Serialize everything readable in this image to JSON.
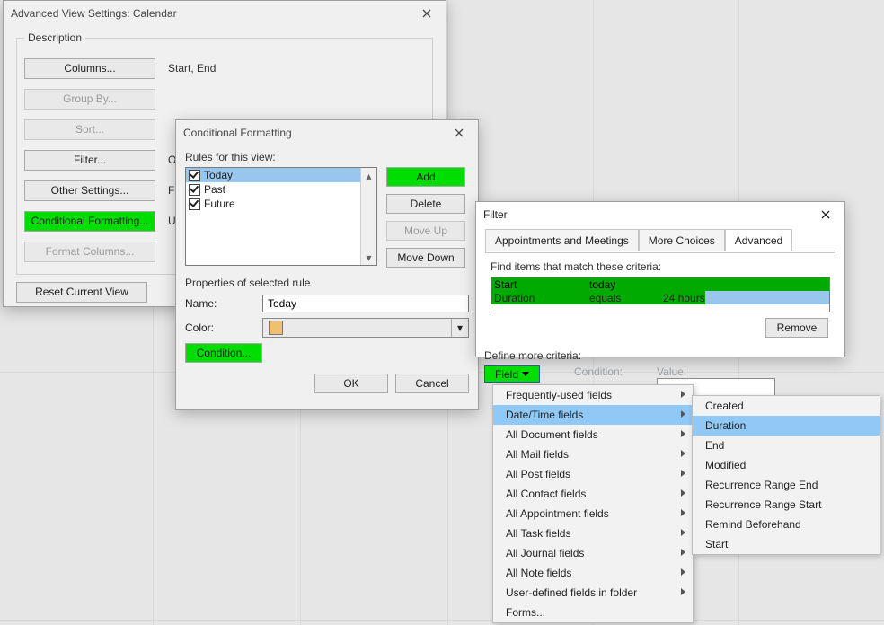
{
  "avs": {
    "title": "Advanced View Settings: Calendar",
    "legend": "Description",
    "columns_btn": "Columns...",
    "columns_val": "Start, End",
    "groupby_btn": "Group By...",
    "sort_btn": "Sort...",
    "filter_btn": "Filter...",
    "filter_val": "Off",
    "other_btn": "Other Settings...",
    "other_val": "For",
    "cond_btn": "Conditional Formatting...",
    "cond_val": "Us",
    "fmtcols_btn": "Format Columns...",
    "reset_btn": "Reset Current View"
  },
  "cf": {
    "title": "Conditional Formatting",
    "rules_label": "Rules for this view:",
    "rules": [
      {
        "label": "Today",
        "selected": true
      },
      {
        "label": "Past",
        "selected": false
      },
      {
        "label": "Future",
        "selected": false
      }
    ],
    "btn_add": "Add",
    "btn_delete": "Delete",
    "btn_moveup": "Move Up",
    "btn_movedown": "Move Down",
    "props_label": "Properties of selected rule",
    "name_label": "Name:",
    "name_value": "Today",
    "color_label": "Color:",
    "cond_btn": "Condition...",
    "ok": "OK",
    "cancel": "Cancel"
  },
  "filter": {
    "title": "Filter",
    "tabs": {
      "t1": "Appointments and Meetings",
      "t2": "More Choices",
      "t3": "Advanced"
    },
    "instr": "Find items that match these criteria:",
    "criteria": [
      {
        "field": "Start",
        "cond": "today",
        "value": ""
      },
      {
        "field": "Duration",
        "cond": "equals",
        "value": "24 hours"
      }
    ],
    "remove": "Remove",
    "defmore": "Define more criteria:",
    "field_btn": "Field",
    "cond_col": "Condition:",
    "value_col": "Value:"
  },
  "menu_cats": {
    "items": [
      "Frequently-used fields",
      "Date/Time fields",
      "All Document fields",
      "All Mail fields",
      "All Post fields",
      "All Contact fields",
      "All Appointment fields",
      "All Task fields",
      "All Journal fields",
      "All Note fields",
      "User-defined fields in folder",
      "Forms..."
    ],
    "highlighted_index": 1
  },
  "menu_dt": {
    "items": [
      "Created",
      "Duration",
      "End",
      "Modified",
      "Recurrence Range End",
      "Recurrence Range Start",
      "Remind Beforehand",
      "Start"
    ],
    "highlighted_index": 1
  }
}
